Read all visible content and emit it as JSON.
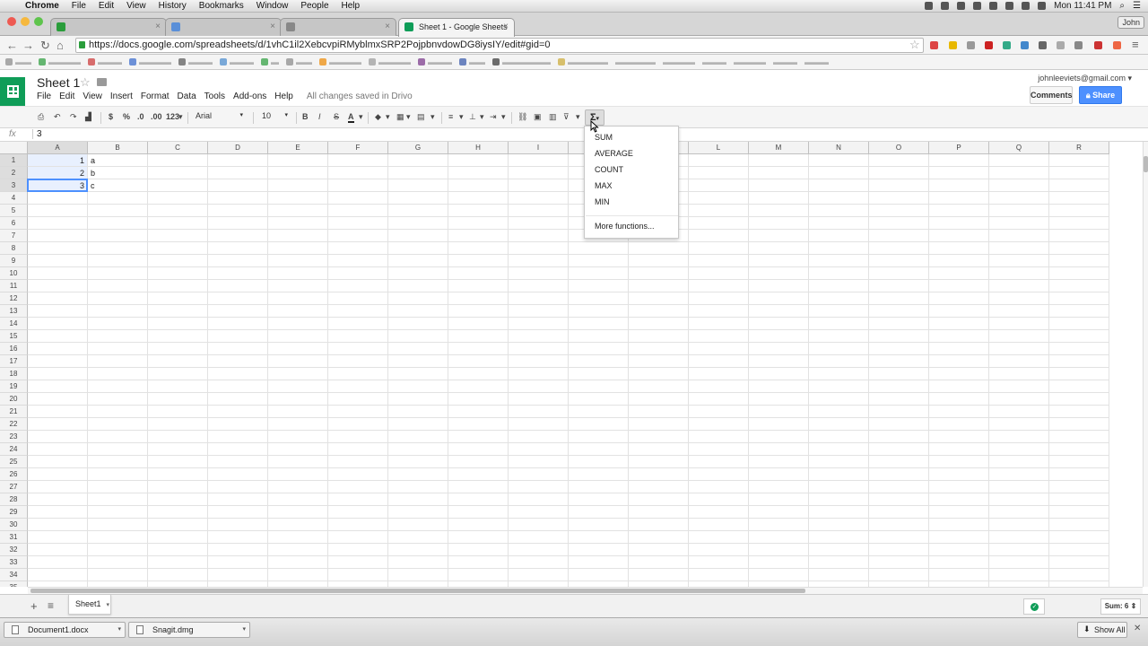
{
  "os_menubar": {
    "app": "Chrome",
    "items": [
      "File",
      "Edit",
      "View",
      "History",
      "Bookmarks",
      "Window",
      "People",
      "Help"
    ],
    "clock": "Mon 11:41 PM"
  },
  "browser": {
    "tabs": [
      {
        "title": "",
        "active": false
      },
      {
        "title": "",
        "active": false
      },
      {
        "title": "",
        "active": false
      },
      {
        "title": "Sheet 1 - Google Sheets",
        "active": true
      }
    ],
    "profile": "John",
    "url": "https://docs.google.com/spreadsheets/d/1vhC1il2XebcvpiRMyblmxSRP2PojpbnvdowDG8iysIY/edit#gid=0"
  },
  "doc": {
    "title": "Sheet 1",
    "menu": [
      "File",
      "Edit",
      "View",
      "Insert",
      "Format",
      "Data",
      "Tools",
      "Add-ons",
      "Help"
    ],
    "save_status": "All changes saved in Drivo",
    "email": "johnleeviets@gmail.com",
    "comments_label": "Comments",
    "share_label": "Share"
  },
  "toolbar": {
    "currency": "$",
    "percent": "%",
    "dec_dec": ".0",
    "dec_inc": ".00",
    "num_format": "123",
    "font": "Arial",
    "size": "10",
    "bold": "B",
    "italic": "I",
    "strike": "S",
    "text_color": "A",
    "sigma": "Σ"
  },
  "formula_bar": {
    "fx": "fx",
    "value": "3"
  },
  "grid": {
    "columns": [
      "A",
      "B",
      "C",
      "D",
      "E",
      "F",
      "G",
      "H",
      "I",
      "J",
      "K",
      "L",
      "M",
      "N",
      "O",
      "P",
      "Q",
      "R"
    ],
    "row_count": 35,
    "rows": [
      [
        "1",
        "a"
      ],
      [
        "2",
        "b"
      ],
      [
        "3",
        "c"
      ]
    ]
  },
  "function_menu": {
    "items": [
      "SUM",
      "AVERAGE",
      "COUNT",
      "MAX",
      "MIN"
    ],
    "more": "More functions..."
  },
  "sheet_tabs": {
    "active": "Sheet1",
    "sum_label": "Sum: 6"
  },
  "downloads": {
    "items": [
      "Document1.docx",
      "Snagit.dmg"
    ],
    "show_all": "Show All"
  },
  "colors": {
    "sheets_green": "#0f9d58",
    "share_blue": "#4d90fe",
    "selection": "#4d90fe"
  }
}
